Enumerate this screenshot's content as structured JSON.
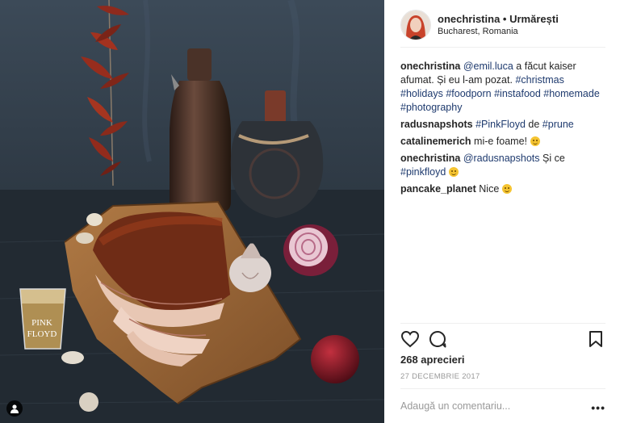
{
  "header": {
    "username": "onechristina",
    "separator": "•",
    "follow_label": "Urmărești",
    "location": "Bucharest, Romania"
  },
  "comments": [
    {
      "user": "onechristina",
      "parts": [
        {
          "t": "link",
          "v": "@emil.luca"
        },
        {
          "t": "text",
          "v": " a făcut kaiser afumat. Și eu l-am pozat. "
        },
        {
          "t": "link",
          "v": "#christmas"
        },
        {
          "t": "text",
          "v": " "
        },
        {
          "t": "link",
          "v": "#holidays"
        },
        {
          "t": "text",
          "v": " "
        },
        {
          "t": "link",
          "v": "#foodporn"
        },
        {
          "t": "text",
          "v": " "
        },
        {
          "t": "link",
          "v": "#instafood"
        },
        {
          "t": "text",
          "v": " "
        },
        {
          "t": "link",
          "v": "#homemade"
        },
        {
          "t": "text",
          "v": " "
        },
        {
          "t": "link",
          "v": "#photography"
        }
      ]
    },
    {
      "user": "radusnapshots",
      "parts": [
        {
          "t": "link",
          "v": "#PinkFloyd"
        },
        {
          "t": "text",
          "v": " de "
        },
        {
          "t": "link",
          "v": "#prune"
        }
      ]
    },
    {
      "user": "catalinemerich",
      "parts": [
        {
          "t": "text",
          "v": "mi-e foame! "
        },
        {
          "t": "emoji",
          "v": "hungry-face-emoji"
        }
      ]
    },
    {
      "user": "onechristina",
      "parts": [
        {
          "t": "link",
          "v": "@radusnapshots"
        },
        {
          "t": "text",
          "v": " Și ce "
        },
        {
          "t": "link",
          "v": "#pinkfloyd"
        },
        {
          "t": "text",
          "v": " "
        },
        {
          "t": "emoji",
          "v": "grin-face-emoji"
        }
      ]
    },
    {
      "user": "pancake_planet",
      "parts": [
        {
          "t": "text",
          "v": "Nice "
        },
        {
          "t": "emoji",
          "v": "wink-face-emoji"
        }
      ]
    }
  ],
  "likes_label": "268 aprecieri",
  "date_label": "27 DECEMBRIE 2017",
  "add_comment_placeholder": "Adaugă un comentariu...",
  "more_label": "•••",
  "photo": {
    "glass_label_line1": "PINK",
    "glass_label_line2": "FLOYD"
  },
  "colors": {
    "link": "#1e3a6e",
    "muted": "#999999",
    "divider": "#efefef"
  },
  "icons": [
    "heart-icon",
    "comment-icon",
    "bookmark-icon",
    "user-tag-icon"
  ]
}
